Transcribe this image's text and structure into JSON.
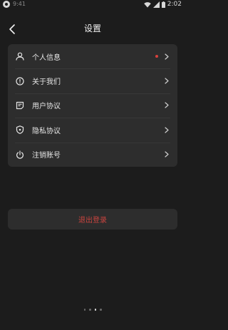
{
  "status_bar": {
    "left_time": "9:41",
    "clock": "2:02"
  },
  "header": {
    "title": "设置"
  },
  "menu": {
    "items": [
      {
        "label": "个人信息",
        "icon": "user-icon",
        "badge": true
      },
      {
        "label": "关于我们",
        "icon": "info-icon",
        "badge": false
      },
      {
        "label": "用户协议",
        "icon": "document-icon",
        "badge": false
      },
      {
        "label": "隐私协议",
        "icon": "shield-icon",
        "badge": false
      },
      {
        "label": "注销账号",
        "icon": "power-icon",
        "badge": false
      }
    ]
  },
  "logout": {
    "label": "退出登录"
  },
  "pager": {
    "count": 4,
    "active_index": 2
  },
  "colors": {
    "background": "#1c1c1c",
    "card": "#2d2d2d",
    "badge": "#d8413c",
    "logout_text": "#c9443f"
  }
}
